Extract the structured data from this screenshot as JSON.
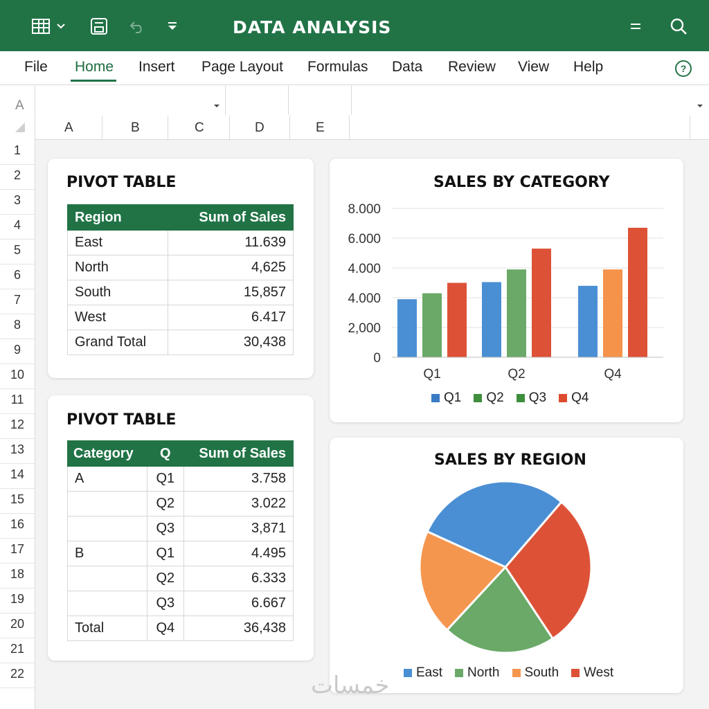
{
  "window": {
    "title": "DATA ANALYSIS"
  },
  "titlebar_icons": [
    "spreadsheet-icon",
    "chevron-down-icon",
    "save-icon",
    "undo-icon",
    "customize-icon",
    "menu-icon",
    "search-icon"
  ],
  "menu": {
    "items": [
      "File",
      "Home",
      "Insert",
      "Page Layout",
      "Formulas",
      "Data",
      "Review",
      "View",
      "Help"
    ],
    "active": "Home"
  },
  "formula_bar": {
    "name_box": "A"
  },
  "columns": [
    "A",
    "B",
    "C",
    "D",
    "E"
  ],
  "rows": [
    "1",
    "2",
    "3",
    "4",
    "5",
    "6",
    "7",
    "8",
    "9",
    "10",
    "11",
    "12",
    "13",
    "14",
    "15",
    "16",
    "17",
    "18",
    "19",
    "20",
    "21",
    "22"
  ],
  "pivot1": {
    "title": "PIVOT TABLE",
    "headers": [
      "Region",
      "Sum of Sales"
    ],
    "rows": [
      [
        "East",
        "11.639"
      ],
      [
        "North",
        "4,625"
      ],
      [
        "South",
        "15,857"
      ],
      [
        "West",
        "6.417"
      ],
      [
        "Grand Total",
        "30,438"
      ]
    ]
  },
  "pivot2": {
    "title": "PIVOT TABLE",
    "headers": [
      "Category",
      "Q",
      "Sum of Sales"
    ],
    "rows": [
      [
        "A",
        "Q1",
        "3.758"
      ],
      [
        "",
        "Q2",
        "3.022"
      ],
      [
        "",
        "Q3",
        "3,871"
      ],
      [
        "B",
        "Q1",
        "4.495"
      ],
      [
        "",
        "Q2",
        "6.333"
      ],
      [
        "",
        "Q3",
        "6.667"
      ],
      [
        "Total",
        "Q4",
        "36,438"
      ]
    ]
  },
  "chart_data": [
    {
      "type": "bar",
      "title": "SALES BY CATEGORY",
      "categories": [
        "Q1",
        "Q2",
        "Q4"
      ],
      "y_ticks": [
        "8.000",
        "6.000",
        "4.000",
        "4.000",
        "2,000",
        "0"
      ],
      "ylim": [
        0,
        10000
      ],
      "grid": true,
      "legend_position": "bottom",
      "series": [
        {
          "name": "Q1",
          "color": "#4a8fd4",
          "values": [
            3900,
            5050,
            4800
          ]
        },
        {
          "name": "Q2",
          "color": "#6aa968",
          "values": [
            4300,
            5900,
            null
          ]
        },
        {
          "name": "Q3",
          "color": "#f5934a",
          "values": [
            null,
            null,
            5900
          ]
        },
        {
          "name": "Q4",
          "color": "#dd5237",
          "values": [
            5000,
            7300,
            8700
          ]
        }
      ],
      "legend": [
        {
          "name": "Q1",
          "color": "#3a7cc4"
        },
        {
          "name": "Q2",
          "color": "#3e8e3e"
        },
        {
          "name": "Q3",
          "color": "#3e8e3e"
        },
        {
          "name": "Q4",
          "color": "#dd4b2e"
        }
      ]
    },
    {
      "type": "pie",
      "title": "SALES BY REGION",
      "legend_position": "bottom",
      "slices": [
        {
          "name": "West",
          "value": 0.294,
          "color": "#dd5237"
        },
        {
          "name": "North",
          "value": 0.212,
          "color": "#6aa968"
        },
        {
          "name": "South",
          "value": 0.199,
          "color": "#f5964f"
        },
        {
          "name": "East",
          "value": 0.295,
          "color": "#4a8fd4"
        }
      ],
      "legend": [
        {
          "name": "East",
          "color": "#4a8fd4"
        },
        {
          "name": "North",
          "color": "#6aa968"
        },
        {
          "name": "South",
          "color": "#f5964f"
        },
        {
          "name": "West",
          "color": "#dd5237"
        }
      ]
    }
  ],
  "watermark": "خمسات"
}
